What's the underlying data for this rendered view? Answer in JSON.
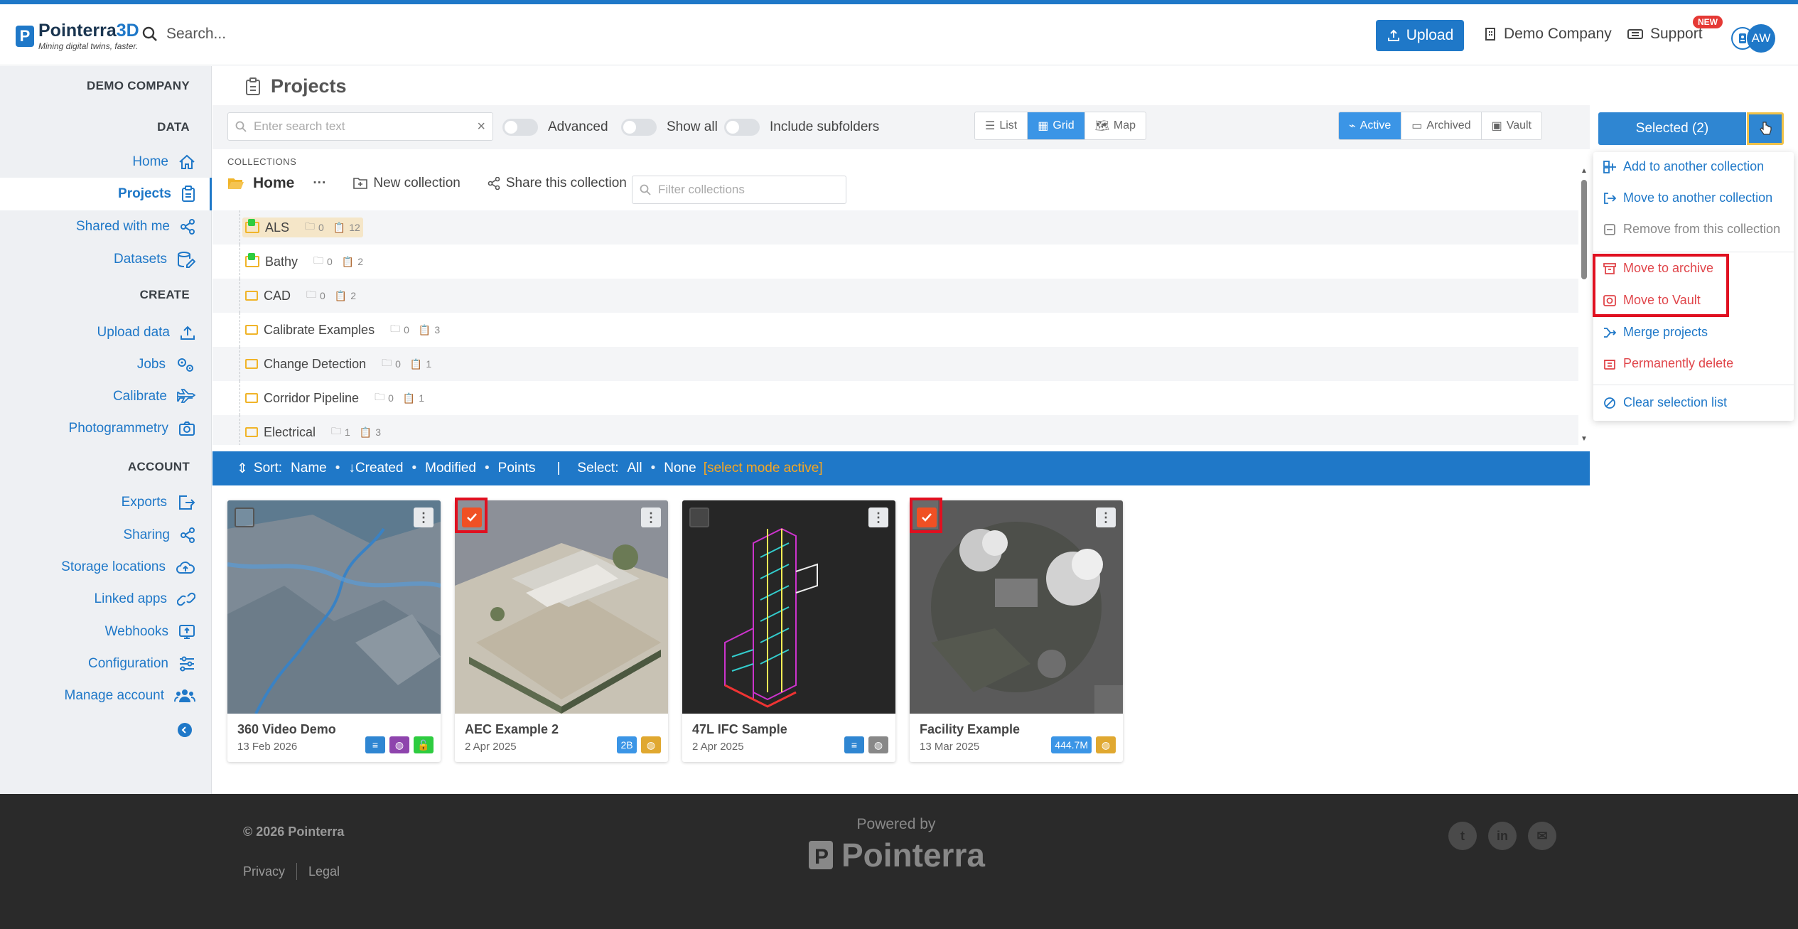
{
  "header": {
    "logo_name_a": "Pointerra",
    "logo_name_b": "3D",
    "logo_tagline": "Mining digital twins, faster.",
    "search_placeholder": "Search...",
    "upload_label": "Upload",
    "company_label": "Demo Company",
    "support_label": "Support",
    "new_badge": "NEW",
    "avatar_initials": "AW"
  },
  "sidebar": {
    "company": "DEMO COMPANY",
    "sections": [
      {
        "title": "DATA",
        "items": [
          {
            "label": "Home",
            "icon": "home-icon"
          },
          {
            "label": "Projects",
            "icon": "clipboard-icon",
            "active": true
          },
          {
            "label": "Shared with me",
            "icon": "share-icon"
          },
          {
            "label": "Datasets",
            "icon": "datasets-icon"
          }
        ]
      },
      {
        "title": "CREATE",
        "items": [
          {
            "label": "Upload data",
            "icon": "upload-icon"
          },
          {
            "label": "Jobs",
            "icon": "gears-icon"
          },
          {
            "label": "Calibrate",
            "icon": "plane-icon"
          },
          {
            "label": "Photogrammetry",
            "icon": "camera-icon"
          }
        ]
      },
      {
        "title": "ACCOUNT",
        "items": [
          {
            "label": "Exports",
            "icon": "export-icon"
          },
          {
            "label": "Sharing",
            "icon": "share-icon"
          },
          {
            "label": "Storage locations",
            "icon": "cloud-upload-icon"
          },
          {
            "label": "Linked apps",
            "icon": "link-icon"
          },
          {
            "label": "Webhooks",
            "icon": "webhook-icon"
          },
          {
            "label": "Configuration",
            "icon": "sliders-icon"
          },
          {
            "label": "Manage account",
            "icon": "users-icon"
          }
        ]
      }
    ]
  },
  "page": {
    "title": "Projects"
  },
  "toolbar": {
    "search_placeholder": "Enter search text",
    "toggle_advanced": "Advanced",
    "toggle_show_all": "Show all",
    "toggle_include_subfolders": "Include subfolders",
    "view_list": "List",
    "view_grid": "Grid",
    "view_map": "Map",
    "filter_active": "Active",
    "filter_archived": "Archived",
    "filter_vault": "Vault",
    "selected_label": "Selected (2)"
  },
  "dropdown": {
    "add_to_collection": "Add to another collection",
    "move_to_collection": "Move to another collection",
    "remove_from_collection": "Remove from this collection",
    "move_to_archive": "Move to archive",
    "move_to_vault": "Move to Vault",
    "merge_projects": "Merge projects",
    "permanently_delete": "Permanently delete",
    "clear_selection": "Clear selection list"
  },
  "collections": {
    "label": "COLLECTIONS",
    "home": "Home",
    "more": "···",
    "new_collection": "New collection",
    "share_collection": "Share this collection",
    "filter_placeholder": "Filter collections",
    "rows": [
      {
        "name": "ALS",
        "folders": "0",
        "projects": "12",
        "shared": true
      },
      {
        "name": "Bathy",
        "folders": "0",
        "projects": "2",
        "shared": true
      },
      {
        "name": "CAD",
        "folders": "0",
        "projects": "2",
        "shared": false
      },
      {
        "name": "Calibrate Examples",
        "folders": "0",
        "projects": "3",
        "shared": false
      },
      {
        "name": "Change Detection",
        "folders": "0",
        "projects": "1",
        "shared": false
      },
      {
        "name": "Corridor Pipeline",
        "folders": "0",
        "projects": "1",
        "shared": false
      },
      {
        "name": "Electrical",
        "folders": "1",
        "projects": "3",
        "shared": false
      }
    ]
  },
  "sortbar": {
    "sort_label": "Sort:",
    "name": "Name",
    "created": "Created",
    "modified": "Modified",
    "points": "Points",
    "divider": "|",
    "select_label": "Select:",
    "all": "All",
    "none": "None",
    "mode_active": "[select mode active]"
  },
  "cards": [
    {
      "name": "360 Video Demo",
      "date": "13 Feb 2026",
      "checked": false,
      "tags": [
        {
          "t": "",
          "c": "#2f86d2",
          "icon": "database-icon"
        },
        {
          "t": "",
          "c": "#8e44ad",
          "icon": "globe-icon"
        },
        {
          "t": "",
          "c": "#2ecc40",
          "icon": "unlock-icon"
        }
      ]
    },
    {
      "name": "AEC Example 2",
      "date": "2 Apr 2025",
      "checked": true,
      "tags": [
        {
          "t": "2B",
          "c": "#3b95e6"
        },
        {
          "t": "",
          "c": "#e0a830",
          "icon": "globe-icon"
        }
      ]
    },
    {
      "name": "47L IFC Sample",
      "date": "2 Apr 2025",
      "checked": false,
      "tags": [
        {
          "t": "",
          "c": "#2f86d2",
          "icon": "database-icon"
        },
        {
          "t": "",
          "c": "#888",
          "icon": "globe-icon"
        }
      ]
    },
    {
      "name": "Facility Example",
      "date": "13 Mar 2025",
      "checked": true,
      "tags": [
        {
          "t": "444.7M",
          "c": "#3b95e6"
        },
        {
          "t": "",
          "c": "#e0a830",
          "icon": "globe-icon"
        }
      ]
    }
  ],
  "footer": {
    "copyright": "© 2026 Pointerra",
    "privacy": "Privacy",
    "legal": "Legal",
    "powered_by": "Powered by",
    "brand": "Pointerra"
  },
  "colors": {
    "accent": "#1f78c8",
    "danger": "#e0454a",
    "selected_check": "#f05024",
    "footer_bg": "#2a2a2a"
  }
}
